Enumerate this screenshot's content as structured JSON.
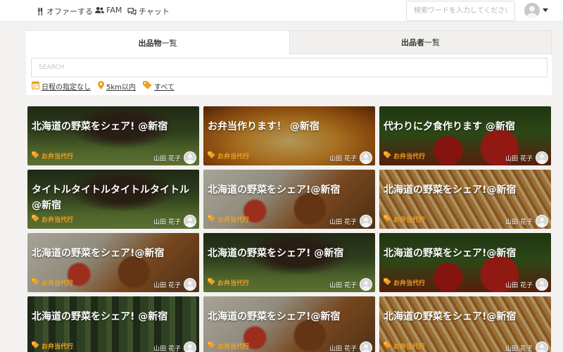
{
  "header": {
    "nav": [
      {
        "icon": "utensils-icon",
        "label": "オファーする"
      },
      {
        "icon": "users-icon",
        "label": "FAM"
      },
      {
        "icon": "chat-icon",
        "label": "チャット"
      }
    ],
    "search_placeholder": "検索ワードを入力してください"
  },
  "tabs": {
    "items": {
      "main": "出品物",
      "sub": "一覧"
    },
    "sellers": {
      "main": "出品者",
      "sub": "一覧"
    }
  },
  "search": {
    "placeholder": "SEARCH"
  },
  "filters": {
    "date": "日程の指定なし",
    "distance": "5km以内",
    "category": "すべて"
  },
  "colors": {
    "accent": "#f0a020"
  },
  "cards": [
    {
      "title": "北海道の野菜をシェア! @新宿",
      "tag": "お弁当代行",
      "user": "山田 花子",
      "bg": "bg-cow"
    },
    {
      "title": "お弁当作ります！ @新宿",
      "tag": "お弁当代行",
      "user": "山田 花子",
      "bg": "bg-torii"
    },
    {
      "title": "代わりに夕食作ります @新宿",
      "tag": "お弁当代行",
      "user": "山田 花子",
      "bg": "bg-tomato"
    },
    {
      "title": "タイトルタイトルタイトルタイトル @新宿",
      "tag": "お弁当代行",
      "user": "山田 花子",
      "bg": "bg-cow"
    },
    {
      "title": "北海道の野菜をシェア!@新宿",
      "tag": "お弁当代行",
      "user": "山田 花子",
      "bg": "bg-bento"
    },
    {
      "title": "北海道の野菜をシェア!@新宿",
      "tag": "お弁当代行",
      "user": "山田 花子",
      "bg": "bg-fries"
    },
    {
      "title": "北海道の野菜をシェア!@新宿",
      "tag": "お弁当代行",
      "user": "山田 花子",
      "bg": "bg-bento"
    },
    {
      "title": "北海道の野菜をシェア! @新宿",
      "tag": "お弁当代行",
      "user": "山田 花子",
      "bg": "bg-cow"
    },
    {
      "title": "北海道の野菜をシェア!@新宿",
      "tag": "お弁当代行",
      "user": "山田 花子",
      "bg": "bg-tomato"
    },
    {
      "title": "北海道の野菜をシェア! @新宿",
      "tag": "お弁当代行",
      "user": "山田 花子",
      "bg": "bg-forest"
    },
    {
      "title": "北海道の野菜をシェア!@新宿",
      "tag": "お弁当代行",
      "user": "山田 花子",
      "bg": "bg-bento"
    },
    {
      "title": "北海道の野菜をシェア!@新宿",
      "tag": "お弁当代行",
      "user": "山田 花子",
      "bg": "bg-fries"
    }
  ]
}
